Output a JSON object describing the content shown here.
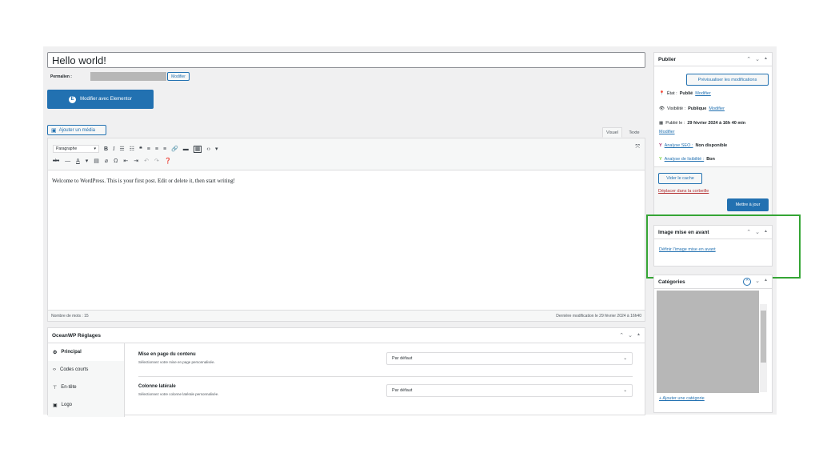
{
  "post": {
    "title": "Hello world!",
    "permalink_label": "Permalien :",
    "permalink_edit": "Modifier",
    "elementor_button": "Modifier avec Elementor",
    "add_media": "Ajouter un média"
  },
  "editor": {
    "tab_visual": "Visuel",
    "tab_text": "Texte",
    "paragraph_select": "Paragraphe",
    "content": "Welcome to WordPress. This is your first post. Edit or delete it, then start writing!",
    "word_count": "Nombre de mots : 15",
    "last_modified": "Dernière modification le 29 février 2024 à 16h40"
  },
  "oceanwp": {
    "title": "OceanWP Réglages",
    "nav": [
      {
        "label": "Principal",
        "icon": "gear-icon"
      },
      {
        "label": "Codes courts",
        "icon": "code-icon"
      },
      {
        "label": "En-tête",
        "icon": "pin-icon"
      },
      {
        "label": "Logo",
        "icon": "image-icon"
      }
    ],
    "settings": [
      {
        "label": "Mise en page du contenu",
        "desc": "Sélectionnez votre mise en page personnalisée.",
        "value": "Par défaut"
      },
      {
        "label": "Colonne latérale",
        "desc": "Sélectionnez votre colonne latérale personnalisée.",
        "value": "Par défaut"
      }
    ]
  },
  "publish": {
    "title": "Publier",
    "preview_button": "Prévisualiser les modifications",
    "status_label": "État :",
    "status_value": "Publié",
    "status_edit": "Modifier",
    "visibility_label": "Visibilité :",
    "visibility_value": "Publique",
    "visibility_edit": "Modifier",
    "published_label": "Publié le :",
    "published_value": "29 février 2024 à 16h 40 min",
    "published_edit": "Modifier",
    "seo_label": "Analyse SEO :",
    "seo_value": "Non disponible",
    "readability_label": "Analyse de lisibilité :",
    "readability_value": "Bon",
    "clear_cache": "Vider le cache",
    "trash": "Déplacer dans la corbeille",
    "update": "Mettre à jour"
  },
  "featured_image": {
    "title": "Image mise en avant",
    "set_link": "Définir l’image mise en avant"
  },
  "categories": {
    "title": "Catégories",
    "add_link": "+ Ajouter une catégorie"
  },
  "colors": {
    "accent": "#2271b1",
    "highlight": "#35a535",
    "danger": "#b32d2e"
  }
}
